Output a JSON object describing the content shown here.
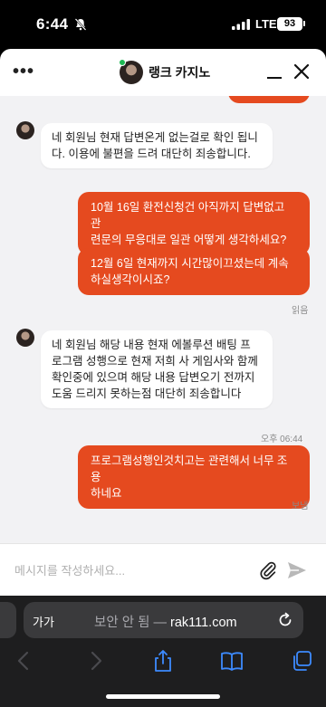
{
  "status_bar": {
    "time": "6:44",
    "network": "LTE",
    "battery": "93"
  },
  "chat": {
    "title": "랭크 카지노",
    "composer_placeholder": "메시지를 작성하세요..."
  },
  "messages": [
    {
      "from": "agent",
      "text_lines": [
        "네 회원님 현재 답변온게 없는걸로 확인 됩니",
        "다. 이용에 불편을 드려 대단히 죄송합니다."
      ]
    },
    {
      "from": "user",
      "text_lines": [
        "10월 16일 환전신청건 아직까지 답변없고 관",
        "련문의 무응대로 일관 어떻게 생각하세요?"
      ]
    },
    {
      "from": "user",
      "text_lines": [
        "12월 6일 현재까지 시간많이끄셨는데 계속",
        "하실생각이시죠?"
      ],
      "status": "읽음"
    },
    {
      "from": "agent",
      "text_lines": [
        "네 회원님 해당 내용 현재 에볼루션 배팅 프",
        "로그램 성행으로 현재 저희 사 게임사와 함께",
        "확인중에 있으며 해당 내용 답변오기 전까지",
        "도움 드리지 못하는점 대단히 죄송합니다"
      ]
    },
    {
      "from": "user",
      "time": "오후 06:44",
      "text_lines": [
        "프로그램성행인것치고는 관련해서 너무 조용",
        "하네요"
      ],
      "status": "보냄"
    }
  ],
  "browser": {
    "text_size_label": "가가",
    "security_label": "보안 안 됨 —",
    "domain": "rak111.com"
  },
  "colors": {
    "brand": "#e54a1f",
    "chat_bg": "#f2f2f4",
    "online": "#1db954"
  },
  "icons": [
    "bell-slash-icon",
    "signal-icon",
    "battery-icon",
    "more-dots-icon",
    "minimize-icon",
    "close-icon",
    "paperclip-icon",
    "send-icon",
    "reload-icon",
    "back-icon",
    "forward-icon",
    "share-icon",
    "bookmarks-icon",
    "tabs-icon"
  ]
}
